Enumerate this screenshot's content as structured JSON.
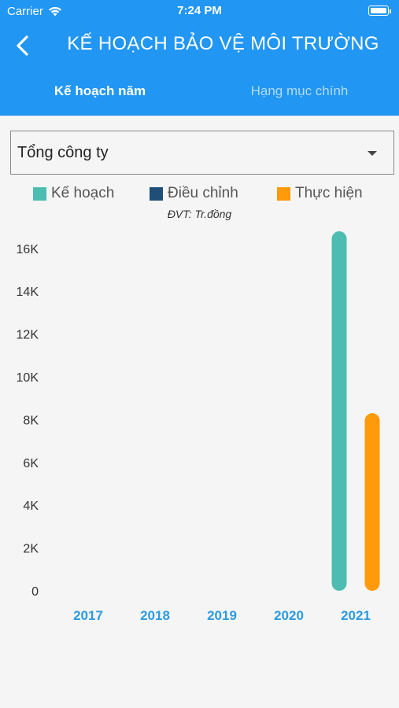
{
  "status_bar": {
    "carrier": "Carrier",
    "time": "7:24 PM"
  },
  "header": {
    "title": "KẾ HOẠCH BẢO VỆ MÔI TRƯỜNG"
  },
  "tabs": [
    {
      "label": "Kế hoạch năm",
      "active": true
    },
    {
      "label": "Hạng mục chính",
      "active": false
    }
  ],
  "dropdown": {
    "value": "Tổng công ty"
  },
  "colors": {
    "header": "#2196f3",
    "ke_hoach": "#4dbdb1",
    "dieu_chinh": "#1f4e79",
    "thuc_hien": "#ff9a0a",
    "axis_label": "#2d9be0"
  },
  "chart_data": {
    "type": "bar",
    "unit": "ĐVT: Tr.đồng",
    "categories": [
      "2017",
      "2018",
      "2019",
      "2020",
      "2021"
    ],
    "series": [
      {
        "name": "Kế hoạch",
        "color": "#4dbdb1",
        "values": [
          0,
          0,
          0,
          0,
          16800
        ]
      },
      {
        "name": "Điều chỉnh",
        "color": "#1f4e79",
        "values": [
          0,
          0,
          0,
          0,
          0
        ]
      },
      {
        "name": "Thực hiện",
        "color": "#ff9a0a",
        "values": [
          0,
          0,
          0,
          0,
          8300
        ]
      }
    ],
    "yticks": [
      "0",
      "2K",
      "4K",
      "6K",
      "8K",
      "10K",
      "12K",
      "14K",
      "16K"
    ],
    "ylim": [
      0,
      16000
    ],
    "grid": false,
    "legend_position": "top"
  }
}
